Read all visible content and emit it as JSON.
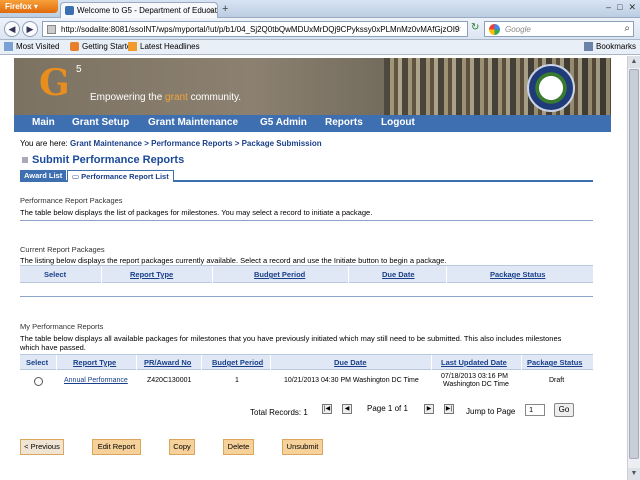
{
  "browser": {
    "menu_label": "Firefox",
    "tab_title": "Welcome to G5 - Department of Educati...",
    "url": "http://sodalite:8081/ssoINT/wps/myportal/!ut/p/b1/04_Sj2Q0tbQwMDUxMrDQj9CPykssy0xPLMnMz0vMAfGjzOI9",
    "search_placeholder": "Google",
    "bookmarks": [
      "Most Visited",
      "Getting Started",
      "Latest Headlines"
    ],
    "bookmarks_right": "Bookmarks"
  },
  "banner": {
    "logo_letter": "G",
    "logo_super": "5",
    "tagline_pre": "Empowering the ",
    "tagline_accent": "grant",
    "tagline_post": " community."
  },
  "menu": [
    "Main",
    "Grant Setup",
    "Grant Maintenance",
    "G5 Admin",
    "Reports",
    "Logout"
  ],
  "breadcrumb": {
    "prefix": "You are here:",
    "path": "Grant Maintenance > Performance Reports > Package Submission"
  },
  "page_title": "Submit Performance Reports",
  "tabs": [
    "Award List",
    "Performance Report List"
  ],
  "sections": {
    "prp_title": "Performance Report Packages",
    "prp_desc": "The table below displays the list of packages for milestones. You may select a record to initiate a package.",
    "crp_title": "Current Report Packages",
    "crp_desc": "The listing below displays the report packages currently available. Select a record and use the Initiate button to begin a package.",
    "mpr_title": "My Performance Reports",
    "mpr_desc_1": "The table below displays all available packages for milestones that you have previously initiated which may still need to be submitted. This also includes milestones",
    "mpr_desc_2": "which have passed."
  },
  "current_table": {
    "headers": [
      "Select",
      "Report Type",
      "Budget Period",
      "Due Date",
      "Package Status"
    ]
  },
  "my_table": {
    "headers": [
      "Select",
      "Report Type",
      "PR/Award No",
      "Budget Period",
      "Due Date",
      "Last Updated Date",
      "Package Status"
    ],
    "rows": [
      {
        "report_type": "Annual Performance",
        "award_no": "Z420C130001",
        "budget_period": "1",
        "due_date": "10/21/2013 04:30 PM Washington DC Time",
        "last_updated_1": "07/18/2013 03:16 PM",
        "last_updated_2": "Washington DC Time",
        "status": "Draft"
      }
    ]
  },
  "pager": {
    "total_label": "Total Records: 1",
    "page_label": "Page 1 of 1",
    "jump_label": "Jump to Page",
    "jump_value": "1",
    "go_label": "Go"
  },
  "actions": [
    "< Previous",
    "Edit Report",
    "Copy",
    "Delete",
    "Unsubmit"
  ]
}
